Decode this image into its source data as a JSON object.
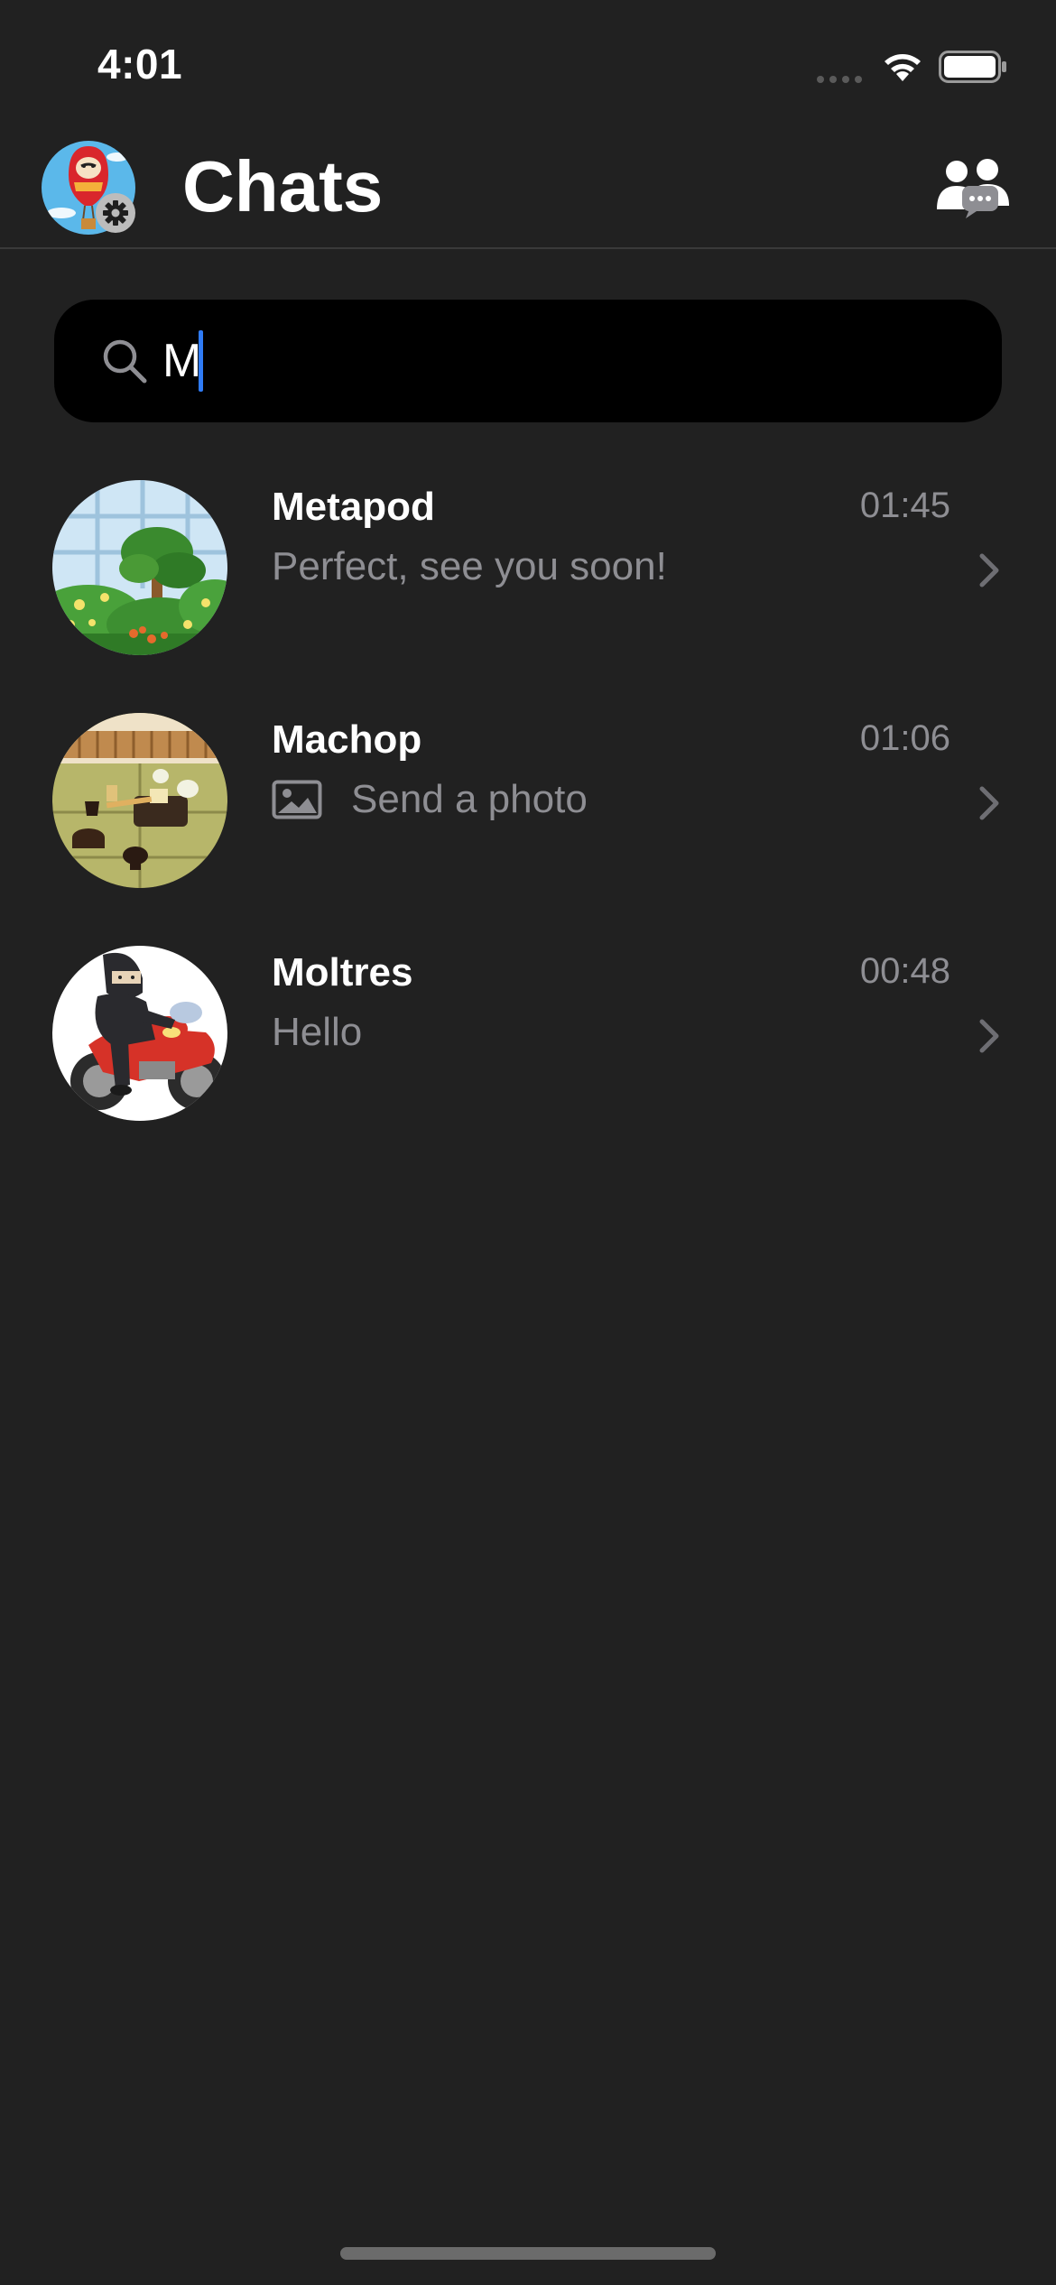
{
  "status_bar": {
    "time": "4:01"
  },
  "header": {
    "title": "Chats"
  },
  "search": {
    "value": "M"
  },
  "chats": [
    {
      "name": "Metapod",
      "time": "01:45",
      "preview": "Perfect, see you soon!",
      "preview_icon": null
    },
    {
      "name": "Machop",
      "time": "01:06",
      "preview": "Send a photo",
      "preview_icon": "photo-icon"
    },
    {
      "name": "Moltres",
      "time": "00:48",
      "preview": "Hello",
      "preview_icon": null
    }
  ],
  "colors": {
    "background": "#212121",
    "search_background": "#000000",
    "secondary_text": "#8e8e93",
    "caret": "#2f7bf5"
  }
}
